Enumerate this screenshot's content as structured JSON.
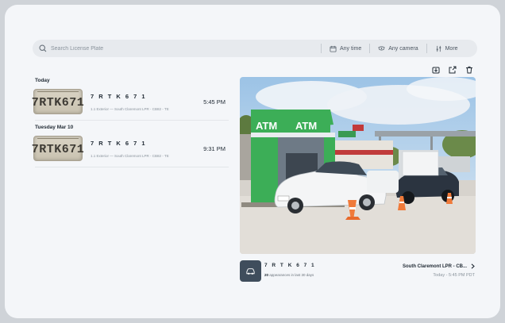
{
  "search": {
    "placeholder": "Search License Plate",
    "filters": {
      "time_label": "Any time",
      "camera_label": "Any camera",
      "more_label": "More"
    }
  },
  "events": {
    "groups": [
      {
        "day": "Today",
        "items": [
          {
            "plate_image_text": "7RTK671",
            "plate": "7 R T K 6 7 1",
            "location": "1.1 Exterior — South Claremont LPR - CB82 - TE",
            "time": "5:45 PM"
          }
        ]
      },
      {
        "day": "Tuesday Mar 10",
        "items": [
          {
            "plate_image_text": "7RTK671",
            "plate": "7 R T K 6 7 1",
            "location": "1.1 Exterior — South Claremont LPR - CB82 - TE",
            "time": "9:31 PM"
          }
        ]
      }
    ]
  },
  "toolbar": {
    "icons": [
      "download-icon",
      "share-icon",
      "trash-icon"
    ]
  },
  "photo": {
    "sign_text": "ATM"
  },
  "detail": {
    "plate": "7 R T K 6 7 1",
    "appearance_count": "20",
    "appearance_suffix": " appearances in last 30 days",
    "camera": "South Claremont LPR - CB...",
    "when": "Today - 5:45 PM PDT"
  },
  "colors": {
    "atm_green": "#3cae57",
    "accent_dark": "#3f4d5c"
  }
}
